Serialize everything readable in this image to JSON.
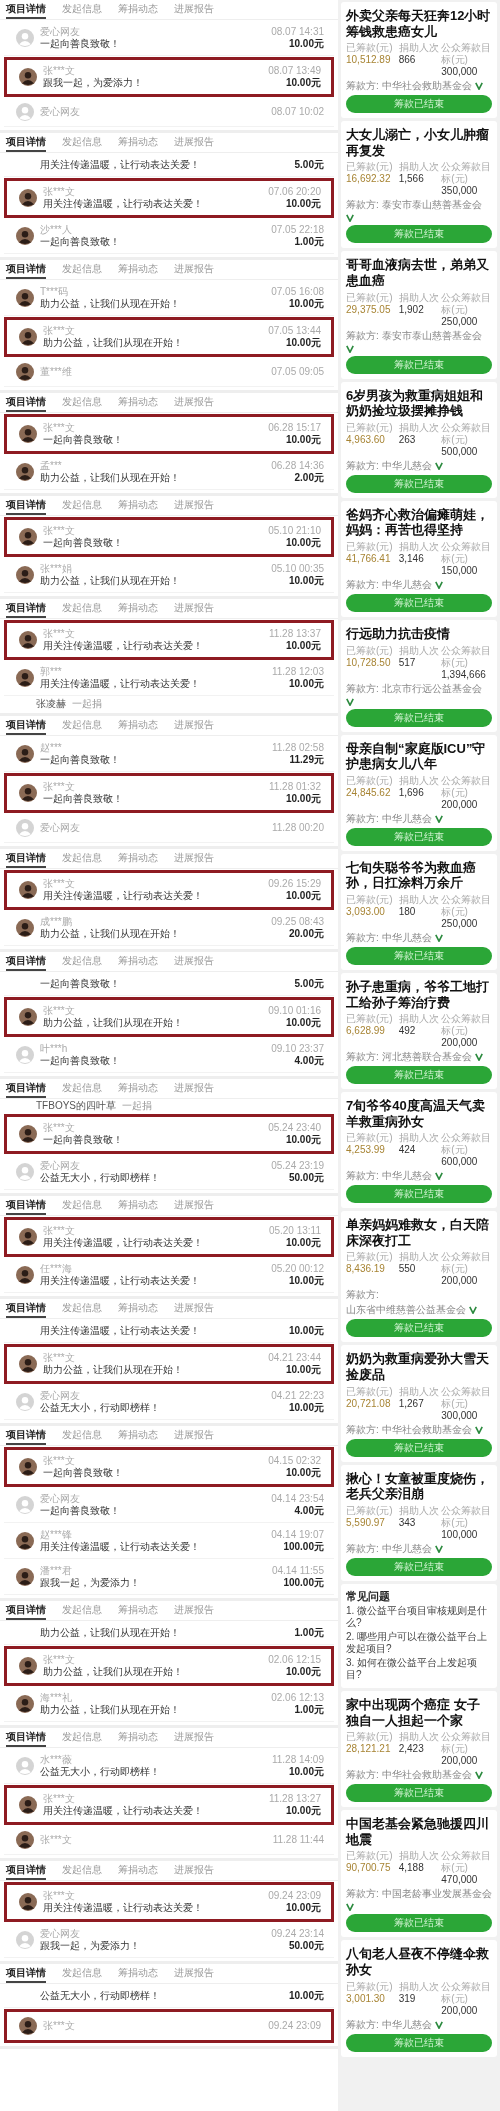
{
  "donation_feed": [
    {
      "tabs": [
        {
          "label": "项目详情",
          "selected": true
        },
        {
          "label": "发起信息",
          "selected": false
        },
        {
          "label": "筹捐动态",
          "selected": false
        },
        {
          "label": "进展报告",
          "selected": false
        }
      ],
      "rows": [
        {
          "kind": "full",
          "highlighted": false,
          "default_avatar": true,
          "name": "爱心网友",
          "time": "08.07 14:31",
          "message": "一起向善良致敬！",
          "amount": "10.00元"
        },
        {
          "kind": "full",
          "highlighted": true,
          "default_avatar": false,
          "name": "张***文",
          "time": "08.07 13:49",
          "message": "跟我一起，为爱添力！",
          "amount": "10.00元"
        },
        {
          "kind": "head",
          "default_avatar": true,
          "name": "爱心网友",
          "time": "08.07 10:02"
        }
      ]
    },
    {
      "tabs": [
        {
          "label": "项目详情",
          "selected": true
        },
        {
          "label": "发起信息",
          "selected": false
        },
        {
          "label": "筹捐动态",
          "selected": false
        },
        {
          "label": "进展报告",
          "selected": false
        }
      ],
      "rows": [
        {
          "kind": "tail",
          "message": "用关注传递温暖，让行动表达关爱！",
          "amount": "5.00元"
        },
        {
          "kind": "full",
          "highlighted": true,
          "default_avatar": false,
          "name": "张***文",
          "time": "07.06 20:20",
          "message": "用关注传递温暖，让行动表达关爱！",
          "amount": "10.00元"
        },
        {
          "kind": "full",
          "highlighted": false,
          "default_avatar": false,
          "name": "沙***人",
          "time": "07.05 22:18",
          "message": "一起向善良致敬！",
          "amount": "1.00元"
        }
      ]
    },
    {
      "tabs": [
        {
          "label": "项目详情",
          "selected": true
        },
        {
          "label": "发起信息",
          "selected": false
        },
        {
          "label": "筹捐动态",
          "selected": false
        },
        {
          "label": "进展报告",
          "selected": false
        }
      ],
      "rows": [
        {
          "kind": "full",
          "highlighted": false,
          "default_avatar": false,
          "name": "T***码",
          "time": "07.05 16:08",
          "message": "助力公益，让我们从现在开始！",
          "amount": "10.00元"
        },
        {
          "kind": "full",
          "highlighted": true,
          "default_avatar": false,
          "name": "张***文",
          "time": "07.05 13:44",
          "message": "助力公益，让我们从现在开始！",
          "amount": "10.00元"
        },
        {
          "kind": "head",
          "default_avatar": false,
          "name": "董***维",
          "time": "07.05 09:05"
        }
      ]
    },
    {
      "tabs": [
        {
          "label": "项目详情",
          "selected": true
        },
        {
          "label": "发起信息",
          "selected": false
        },
        {
          "label": "筹捐动态",
          "selected": false
        },
        {
          "label": "进展报告",
          "selected": false
        }
      ],
      "rows": [
        {
          "kind": "full",
          "highlighted": true,
          "default_avatar": false,
          "name": "张***文",
          "time": "06.28 15:17",
          "message": "一起向善良致敬！",
          "amount": "10.00元"
        },
        {
          "kind": "full",
          "highlighted": false,
          "default_avatar": false,
          "name": "孟***",
          "time": "06.28 14:36",
          "message": "助力公益，让我们从现在开始！",
          "amount": "2.00元"
        }
      ]
    },
    {
      "tabs": [
        {
          "label": "项目详情",
          "selected": true
        },
        {
          "label": "发起信息",
          "selected": false
        },
        {
          "label": "筹捐动态",
          "selected": false
        },
        {
          "label": "进展报告",
          "selected": false
        }
      ],
      "rows": [
        {
          "kind": "full",
          "highlighted": true,
          "default_avatar": false,
          "name": "张***文",
          "time": "05.10 21:10",
          "message": "一起向善良致敬！",
          "amount": "10.00元"
        },
        {
          "kind": "full",
          "highlighted": false,
          "default_avatar": false,
          "name": "张***娟",
          "time": "05.10 00:35",
          "message": "助力公益，让我们从现在开始！",
          "amount": "10.00元"
        }
      ]
    },
    {
      "tabs": [
        {
          "label": "项目详情",
          "selected": true
        },
        {
          "label": "发起信息",
          "selected": false
        },
        {
          "label": "筹捐动态",
          "selected": false
        },
        {
          "label": "进展报告",
          "selected": false
        }
      ],
      "rows": [
        {
          "kind": "full",
          "highlighted": true,
          "default_avatar": false,
          "name": "张***文",
          "time": "11.28 13:37",
          "message": "用关注传递温暖，让行动表达关爱！",
          "amount": "10.00元"
        },
        {
          "kind": "full",
          "highlighted": false,
          "default_avatar": false,
          "name": "郭***",
          "time": "11.28 12:03",
          "message": "用关注传递温暖，让行动表达关爱！",
          "amount": "10.00元"
        },
        {
          "kind": "join",
          "name": "张凌赫",
          "action": "一起捐"
        }
      ]
    },
    {
      "tabs": [
        {
          "label": "项目详情",
          "selected": true
        },
        {
          "label": "发起信息",
          "selected": false
        },
        {
          "label": "筹捐动态",
          "selected": false
        },
        {
          "label": "进展报告",
          "selected": false
        }
      ],
      "rows": [
        {
          "kind": "full",
          "highlighted": false,
          "default_avatar": false,
          "name": "赵***",
          "time": "11.28 02:58",
          "message": "一起向善良致敬！",
          "amount": "11.29元"
        },
        {
          "kind": "full",
          "highlighted": true,
          "default_avatar": false,
          "name": "张***文",
          "time": "11.28 01:32",
          "message": "一起向善良致敬！",
          "amount": "10.00元"
        },
        {
          "kind": "head",
          "default_avatar": true,
          "name": "爱心网友",
          "time": "11.28 00:20"
        }
      ]
    },
    {
      "tabs": [
        {
          "label": "项目详情",
          "selected": true
        },
        {
          "label": "发起信息",
          "selected": false
        },
        {
          "label": "筹捐动态",
          "selected": false
        },
        {
          "label": "进展报告",
          "selected": false
        }
      ],
      "rows": [
        {
          "kind": "full",
          "highlighted": true,
          "default_avatar": false,
          "name": "张***文",
          "time": "09.26 15:29",
          "message": "用关注传递温暖，让行动表达关爱！",
          "amount": "10.00元"
        },
        {
          "kind": "full",
          "highlighted": false,
          "default_avatar": false,
          "name": "成***鹏",
          "time": "09.25 08:43",
          "message": "助力公益，让我们从现在开始！",
          "amount": "20.00元"
        }
      ]
    },
    {
      "tabs": [
        {
          "label": "项目详情",
          "selected": true
        },
        {
          "label": "发起信息",
          "selected": false
        },
        {
          "label": "筹捐动态",
          "selected": false
        },
        {
          "label": "进展报告",
          "selected": false
        }
      ],
      "rows": [
        {
          "kind": "tail",
          "message": "一起向善良致敬！",
          "amount": "5.00元"
        },
        {
          "kind": "full",
          "highlighted": true,
          "default_avatar": false,
          "name": "张***文",
          "time": "09.10 01:16",
          "message": "助力公益，让我们从现在开始！",
          "amount": "10.00元"
        },
        {
          "kind": "full",
          "highlighted": false,
          "default_avatar": true,
          "name": "叶***h",
          "time": "09.10 23:37",
          "message": "一起向善良致敬！",
          "amount": "4.00元"
        }
      ]
    },
    {
      "tabs": [
        {
          "label": "项目详情",
          "selected": true
        },
        {
          "label": "发起信息",
          "selected": false
        },
        {
          "label": "筹捐动态",
          "selected": false
        },
        {
          "label": "进展报告",
          "selected": false
        }
      ],
      "rows": [
        {
          "kind": "join",
          "name": "TFBOYS的四叶草",
          "action": "一起捐"
        },
        {
          "kind": "full",
          "highlighted": true,
          "default_avatar": false,
          "name": "张***文",
          "time": "05.24 23:40",
          "message": "一起向善良致敬！",
          "amount": "10.00元"
        },
        {
          "kind": "full",
          "highlighted": false,
          "default_avatar": true,
          "name": "爱心网友",
          "time": "05.24 23:19",
          "message": "公益无大小，行动即榜样！",
          "amount": "50.00元"
        }
      ]
    },
    {
      "tabs": [
        {
          "label": "项目详情",
          "selected": true
        },
        {
          "label": "发起信息",
          "selected": false
        },
        {
          "label": "筹捐动态",
          "selected": false
        },
        {
          "label": "进展报告",
          "selected": false
        }
      ],
      "rows": [
        {
          "kind": "full",
          "highlighted": true,
          "default_avatar": false,
          "name": "张***文",
          "time": "05.20 13:11",
          "message": "用关注传递温暖，让行动表达关爱！",
          "amount": "10.00元"
        },
        {
          "kind": "full",
          "highlighted": false,
          "default_avatar": false,
          "name": "任***海",
          "time": "05.20 00:12",
          "message": "用关注传递温暖，让行动表达关爱！",
          "amount": "10.00元"
        }
      ]
    },
    {
      "tabs": [
        {
          "label": "项目详情",
          "selected": true
        },
        {
          "label": "发起信息",
          "selected": false
        },
        {
          "label": "筹捐动态",
          "selected": false
        },
        {
          "label": "进展报告",
          "selected": false
        }
      ],
      "rows": [
        {
          "kind": "tail",
          "message": "用关注传递温暖，让行动表达关爱！",
          "amount": "10.00元"
        },
        {
          "kind": "full",
          "highlighted": true,
          "default_avatar": false,
          "name": "张***文",
          "time": "04.21 23:44",
          "message": "助力公益，让我们从现在开始！",
          "amount": "10.00元"
        },
        {
          "kind": "full",
          "highlighted": false,
          "default_avatar": true,
          "name": "爱心网友",
          "time": "04.21 22:23",
          "message": "公益无大小，行动即榜样！",
          "amount": "10.00元"
        }
      ]
    },
    {
      "tabs": [
        {
          "label": "项目详情",
          "selected": true
        },
        {
          "label": "发起信息",
          "selected": false
        },
        {
          "label": "筹捐动态",
          "selected": false
        },
        {
          "label": "进展报告",
          "selected": false
        }
      ],
      "rows": [
        {
          "kind": "full",
          "highlighted": true,
          "default_avatar": false,
          "name": "张***文",
          "time": "04.15 02:32",
          "message": "一起向善良致敬！",
          "amount": "10.00元"
        },
        {
          "kind": "full",
          "highlighted": false,
          "default_avatar": true,
          "name": "爱心网友",
          "time": "04.14 23:54",
          "message": "一起向善良致敬！",
          "amount": "4.00元"
        },
        {
          "kind": "full",
          "highlighted": false,
          "default_avatar": false,
          "name": "赵***锋",
          "time": "04.14 19:07",
          "message": "用关注传递温暖，让行动表达关爱！",
          "amount": "100.00元"
        },
        {
          "kind": "full",
          "highlighted": false,
          "default_avatar": false,
          "name": "潘***君",
          "time": "04.14 11:55",
          "message": "跟我一起，为爱添力！",
          "amount": "100.00元"
        }
      ]
    },
    {
      "tabs": [
        {
          "label": "项目详情",
          "selected": true
        },
        {
          "label": "发起信息",
          "selected": false
        },
        {
          "label": "筹捐动态",
          "selected": false
        },
        {
          "label": "进展报告",
          "selected": false
        }
      ],
      "rows": [
        {
          "kind": "tail",
          "message": "助力公益，让我们从现在开始！",
          "amount": "1.00元"
        },
        {
          "kind": "full",
          "highlighted": true,
          "default_avatar": false,
          "name": "张***文",
          "time": "02.06 12:15",
          "message": "助力公益，让我们从现在开始！",
          "amount": "10.00元"
        },
        {
          "kind": "full",
          "highlighted": false,
          "default_avatar": false,
          "name": "海***礼",
          "time": "02.06 12:13",
          "message": "助力公益，让我们从现在开始！",
          "amount": "1.00元"
        }
      ]
    },
    {
      "tabs": [
        {
          "label": "项目详情",
          "selected": true
        },
        {
          "label": "发起信息",
          "selected": false
        },
        {
          "label": "筹捐动态",
          "selected": false
        },
        {
          "label": "进展报告",
          "selected": false
        }
      ],
      "rows": [
        {
          "kind": "full",
          "highlighted": false,
          "default_avatar": true,
          "name": "水***薇",
          "time": "11.28 14:09",
          "message": "公益无大小，行动即榜样！",
          "amount": "10.00元"
        },
        {
          "kind": "full",
          "highlighted": true,
          "default_avatar": false,
          "name": "张***文",
          "time": "11.28 13:27",
          "message": "用关注传递温暖，让行动表达关爱！",
          "amount": "10.00元"
        },
        {
          "kind": "head",
          "default_avatar": false,
          "name": "张***文",
          "time": "11.28 11:44"
        }
      ]
    },
    {
      "tabs": [
        {
          "label": "项目详情",
          "selected": true
        },
        {
          "label": "发起信息",
          "selected": false
        },
        {
          "label": "筹捐动态",
          "selected": false
        },
        {
          "label": "进展报告",
          "selected": false
        }
      ],
      "rows": [
        {
          "kind": "full",
          "highlighted": true,
          "default_avatar": false,
          "name": "张***文",
          "time": "09.24 23:09",
          "message": "用关注传递温暖，让行动表达关爱！",
          "amount": "10.00元"
        },
        {
          "kind": "full",
          "highlighted": false,
          "default_avatar": true,
          "name": "爱心网友",
          "time": "09.24 23:14",
          "message": "跟我一起，为爱添力！",
          "amount": "50.00元"
        }
      ]
    },
    {
      "tabs": [
        {
          "label": "项目详情",
          "selected": true
        },
        {
          "label": "发起信息",
          "selected": false
        },
        {
          "label": "筹捐动态",
          "selected": false
        },
        {
          "label": "进展报告",
          "selected": false
        }
      ],
      "rows": [
        {
          "kind": "tail",
          "message": "公益无大小，行动即榜样！",
          "amount": "10.00元"
        },
        {
          "kind": "head",
          "highlighted": true,
          "default_avatar": false,
          "name": "张***文",
          "time": "09.24 23:09"
        }
      ]
    }
  ],
  "projects": [
    {
      "kind": "project",
      "title": "外卖父亲每天狂奔12小时筹钱救患癌女儿",
      "raised_label": "已筹款(元)",
      "raised": "10,512.89",
      "donors_label": "捐助人次",
      "donors": "866",
      "goal_label": "公众筹款目标(元)",
      "goal": "300,000",
      "org_label": "筹款方:",
      "org": "中华社会救助基金会",
      "button": "筹款已结束"
    },
    {
      "kind": "project",
      "title": "大女儿溺亡，小女儿肿瘤再复发",
      "raised_label": "已筹款(元)",
      "raised": "16,692.32",
      "donors_label": "捐助人次",
      "donors": "1,566",
      "goal_label": "公众筹款目标(元)",
      "goal": "350,000",
      "org_label": "筹款方:",
      "org": "泰安市泰山慈善基金会",
      "button": "筹款已结束"
    },
    {
      "kind": "project",
      "title": "哥哥血液病去世，弟弟又患血癌",
      "raised_label": "已筹款(元)",
      "raised": "29,375.05",
      "donors_label": "捐助人次",
      "donors": "1,902",
      "goal_label": "公众筹款目标(元)",
      "goal": "250,000",
      "org_label": "筹款方:",
      "org": "泰安市泰山慈善基金会",
      "button": "筹款已结束"
    },
    {
      "kind": "project",
      "title": "6岁男孩为救重病姐姐和奶奶捡垃圾摆摊挣钱",
      "raised_label": "已筹款(元)",
      "raised": "4,963.60",
      "donors_label": "捐助人次",
      "donors": "263",
      "goal_label": "公众筹款目标(元)",
      "goal": "500,000",
      "org_label": "筹款方:",
      "org": "中华儿慈会",
      "button": "筹款已结束"
    },
    {
      "kind": "project",
      "title": "爸妈齐心救治偏瘫萌娃，妈妈：再苦也得坚持",
      "raised_label": "已筹款(元)",
      "raised": "41,766.41",
      "donors_label": "捐助人次",
      "donors": "3,146",
      "goal_label": "公众筹款目标(元)",
      "goal": "150,000",
      "org_label": "筹款方:",
      "org": "中华儿慈会",
      "button": "筹款已结束"
    },
    {
      "kind": "project",
      "title": "行远助力抗击疫情",
      "raised_label": "已筹款(元)",
      "raised": "10,728.50",
      "donors_label": "捐助人次",
      "donors": "517",
      "goal_label": "公众筹款目标(元)",
      "goal": "1,394,666",
      "org_label": "筹款方:",
      "org": "北京市行远公益基金会",
      "button": "筹款已结束"
    },
    {
      "kind": "project",
      "title": "母亲自制“家庭版ICU”守护患病女儿八年",
      "raised_label": "已筹款(元)",
      "raised": "24,845.62",
      "donors_label": "捐助人次",
      "donors": "1,696",
      "goal_label": "公众筹款目标(元)",
      "goal": "200,000",
      "org_label": "筹款方:",
      "org": "中华儿慈会",
      "button": "筹款已结束"
    },
    {
      "kind": "project",
      "title": "七旬失聪爷爷为救血癌孙，日扛涂料万余斤",
      "raised_label": "已筹款(元)",
      "raised": "3,093.00",
      "donors_label": "捐助人次",
      "donors": "180",
      "goal_label": "公众筹款目标(元)",
      "goal": "250,000",
      "org_label": "筹款方:",
      "org": "中华儿慈会",
      "button": "筹款已结束"
    },
    {
      "kind": "project",
      "title": "孙子患重病，爷爷工地打工给孙子筹治疗费",
      "raised_label": "已筹款(元)",
      "raised": "6,628.99",
      "donors_label": "捐助人次",
      "donors": "492",
      "goal_label": "公众筹款目标(元)",
      "goal": "200,000",
      "org_label": "筹款方:",
      "org": "河北慈善联合基金会",
      "button": "筹款已结束"
    },
    {
      "kind": "project",
      "title": "7旬爷爷40度高温天气卖羊救重病孙女",
      "raised_label": "已筹款(元)",
      "raised": "4,253.99",
      "donors_label": "捐助人次",
      "donors": "424",
      "goal_label": "公众筹款目标(元)",
      "goal": "600,000",
      "org_label": "筹款方:",
      "org": "中华儿慈会",
      "button": "筹款已结束"
    },
    {
      "kind": "project",
      "title": "单亲妈妈难救女，白天陪床深夜打工",
      "raised_label": "已筹款(元)",
      "raised": "8,436.19",
      "donors_label": "捐助人次",
      "donors": "550",
      "goal_label": "公众筹款目标(元)",
      "goal": "200,000",
      "org_label": "筹款方:",
      "org": "山东省中维慈善公益基金会",
      "button": "筹款已结束"
    },
    {
      "kind": "project",
      "title": "奶奶为救重病爱孙大雪天捡废品",
      "raised_label": "已筹款(元)",
      "raised": "20,721.08",
      "donors_label": "捐助人次",
      "donors": "1,267",
      "goal_label": "公众筹款目标(元)",
      "goal": "300,000",
      "org_label": "筹款方:",
      "org": "中华社会救助基金会",
      "button": "筹款已结束"
    },
    {
      "kind": "project",
      "title": "揪心！女童被重度烧伤，老兵父亲泪崩",
      "raised_label": "已筹款(元)",
      "raised": "5,590.97",
      "donors_label": "捐助人次",
      "donors": "343",
      "goal_label": "公众筹款目标(元)",
      "goal": "100,000",
      "org_label": "筹款方:",
      "org": "中华儿慈会",
      "button": "筹款已结束"
    },
    {
      "kind": "faq",
      "title": "常见问题",
      "questions": [
        "1. 微公益平台项目审核规则是什么?",
        "2. 哪些用户可以在微公益平台上发起项目?",
        "3. 如何在微公益平台上发起项目?"
      ]
    },
    {
      "kind": "project",
      "title": "家中出现两个癌症 女子独自一人担起一个家",
      "raised_label": "已筹款(元)",
      "raised": "28,121.21",
      "donors_label": "捐助人次",
      "donors": "2,423",
      "goal_label": "公众筹款目标(元)",
      "goal": "200,000",
      "org_label": "筹款方:",
      "org": "中华社会救助基金会",
      "button": "筹款已结束"
    },
    {
      "kind": "project",
      "title": "中国老基会紧急驰援四川地震",
      "raised_label": "已筹款(元)",
      "raised": "90,700.75",
      "donors_label": "捐助人次",
      "donors": "4,188",
      "goal_label": "公众筹款目标(元)",
      "goal": "470,000",
      "org_label": "筹款方:",
      "org": "中国老龄事业发展基金会",
      "button": "筹款已结束"
    },
    {
      "kind": "project",
      "title": "八旬老人昼夜不停缝伞救孙女",
      "raised_label": "已筹款(元)",
      "raised": "3,001.30",
      "donors_label": "捐助人次",
      "donors": "319",
      "goal_label": "公众筹款目标(元)",
      "goal": "200,000",
      "org_label": "筹款方:",
      "org": "中华儿慈会",
      "button": "筹款已结束"
    }
  ]
}
